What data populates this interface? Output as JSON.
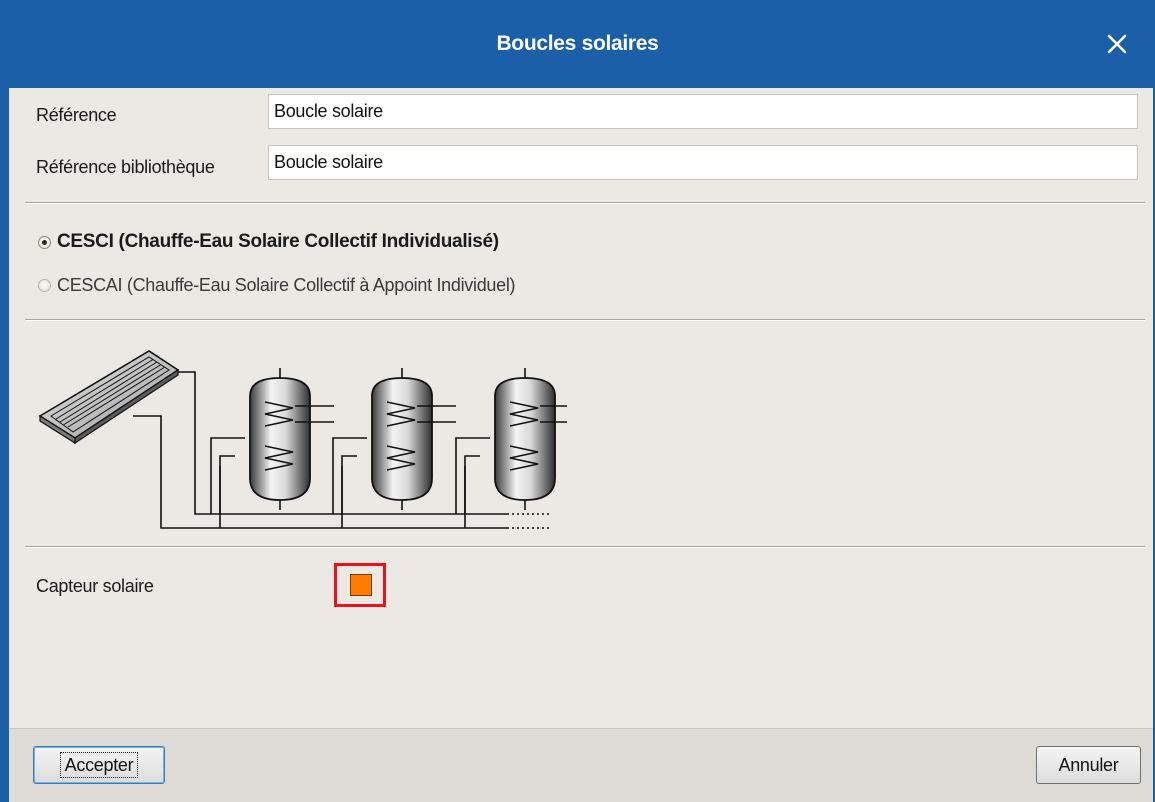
{
  "window": {
    "title": "Boucles solaires",
    "close_label": "Fermer"
  },
  "fields": {
    "reference": {
      "label": "Référence",
      "value": "Boucle solaire"
    },
    "library_reference": {
      "label": "Référence bibliothèque",
      "value": "Boucle solaire"
    }
  },
  "options": {
    "cesci": {
      "label": "CESCI (Chauffe-Eau Solaire Collectif Individualisé)",
      "checked": true
    },
    "cescai": {
      "label": "CESCAI (Chauffe-Eau Solaire Collectif à Appoint Individuel)",
      "checked": false
    }
  },
  "solar_collector": {
    "label": "Capteur solaire",
    "color": "#ff7c00"
  },
  "buttons": {
    "accept": "Accepter",
    "cancel": "Annuler"
  },
  "colors": {
    "titlebar": "#1a5fa8",
    "client_bg": "#ece9e4",
    "selection_frame": "#e8141b"
  },
  "icons": {
    "close": "close-icon",
    "diagram": "solar-loop-diagram"
  }
}
